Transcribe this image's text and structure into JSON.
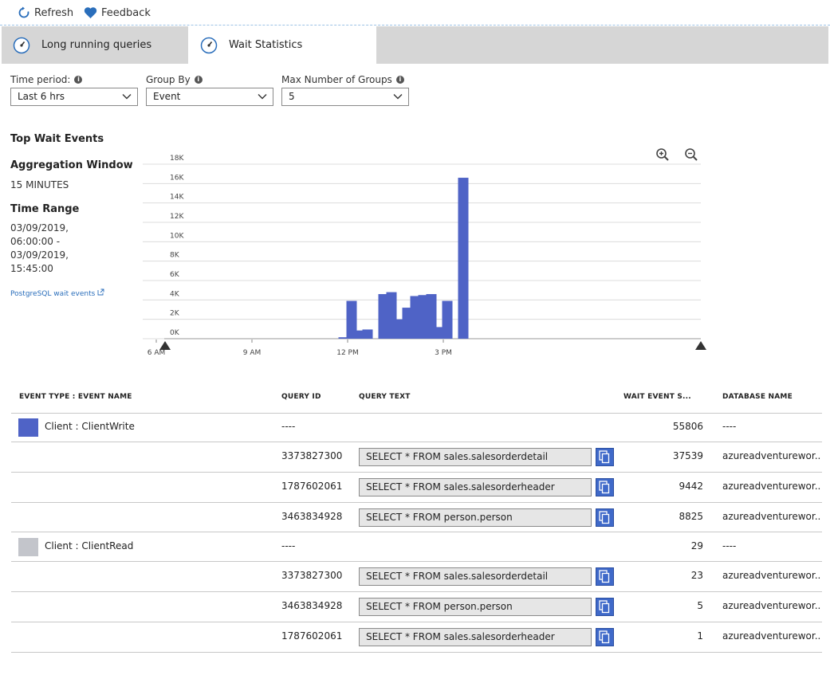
{
  "toolbar": {
    "refresh_label": "Refresh",
    "feedback_label": "Feedback"
  },
  "tabs": [
    {
      "label": "Long running queries",
      "active": false
    },
    {
      "label": "Wait Statistics",
      "active": true
    }
  ],
  "filters": {
    "time_period": {
      "label": "Time period:",
      "value": "Last 6 hrs"
    },
    "group_by": {
      "label": "Group By",
      "value": "Event"
    },
    "max_groups": {
      "label": "Max Number of Groups",
      "value": "5"
    }
  },
  "side": {
    "title": "Top Wait Events",
    "aggregation_heading": "Aggregation Window",
    "aggregation_value": "15 MINUTES",
    "time_range_heading": "Time Range",
    "time_range_lines": [
      "03/09/2019,",
      "06:00:00 -",
      "03/09/2019,",
      "15:45:00"
    ],
    "link": "PostgreSQL wait events"
  },
  "colors": {
    "bar": "#4f63c6",
    "client_write": "#4f63c6",
    "client_read": "#c3c5cb",
    "copy_button": "#3f69c9"
  },
  "chart_data": {
    "type": "bar",
    "title": "",
    "xlabel": "",
    "ylabel": "",
    "ylim": [
      0,
      18000
    ],
    "grid": true,
    "y_ticks": [
      "0K",
      "2K",
      "4K",
      "6K",
      "8K",
      "10K",
      "12K",
      "14K",
      "16K",
      "18K"
    ],
    "x_ticks": [
      "6 AM",
      "9 AM",
      "12 PM",
      "3 PM"
    ],
    "x_range": [
      "06:00",
      "15:45"
    ],
    "x": [
      "11:45",
      "12:00",
      "12:15",
      "12:30",
      "12:45",
      "13:00",
      "13:15",
      "13:30",
      "13:45",
      "14:00",
      "14:15",
      "14:30",
      "14:45",
      "15:00",
      "15:15",
      "15:30"
    ],
    "values": [
      150,
      3900,
      850,
      950,
      0,
      4600,
      4800,
      2000,
      3200,
      4400,
      4500,
      4600,
      1200,
      3900,
      0,
      16600
    ]
  },
  "zoom": {
    "in_icon": "zoom-in-icon",
    "out_icon": "zoom-out-icon"
  },
  "table": {
    "headers": {
      "event": "EVENT TYPE : EVENT NAME",
      "query_id": "QUERY ID",
      "query_text": "QUERY TEXT",
      "wait": "WAIT EVENT S...",
      "db": "DATABASE NAME"
    },
    "rows": [
      {
        "group": true,
        "event": "Client : ClientWrite",
        "query_id": "----",
        "query_text": "",
        "wait": "55806",
        "db": "----"
      },
      {
        "group": false,
        "event": "",
        "query_id": "3373827300",
        "query_text": "SELECT * FROM sales.salesorderdetail",
        "wait": "37539",
        "db": "azureadventurewor..."
      },
      {
        "group": false,
        "event": "",
        "query_id": "1787602061",
        "query_text": "SELECT * FROM sales.salesorderheader",
        "wait": "9442",
        "db": "azureadventurewor..."
      },
      {
        "group": false,
        "event": "",
        "query_id": "3463834928",
        "query_text": "SELECT * FROM person.person",
        "wait": "8825",
        "db": "azureadventurewor..."
      },
      {
        "group": true,
        "event": "Client : ClientRead",
        "query_id": "----",
        "query_text": "",
        "wait": "29",
        "db": "----"
      },
      {
        "group": false,
        "event": "",
        "query_id": "3373827300",
        "query_text": "SELECT * FROM sales.salesorderdetail",
        "wait": "23",
        "db": "azureadventurewor..."
      },
      {
        "group": false,
        "event": "",
        "query_id": "3463834928",
        "query_text": "SELECT * FROM person.person",
        "wait": "5",
        "db": "azureadventurewor..."
      },
      {
        "group": false,
        "event": "",
        "query_id": "1787602061",
        "query_text": "SELECT * FROM sales.salesorderheader",
        "wait": "1",
        "db": "azureadventurewor..."
      }
    ]
  }
}
